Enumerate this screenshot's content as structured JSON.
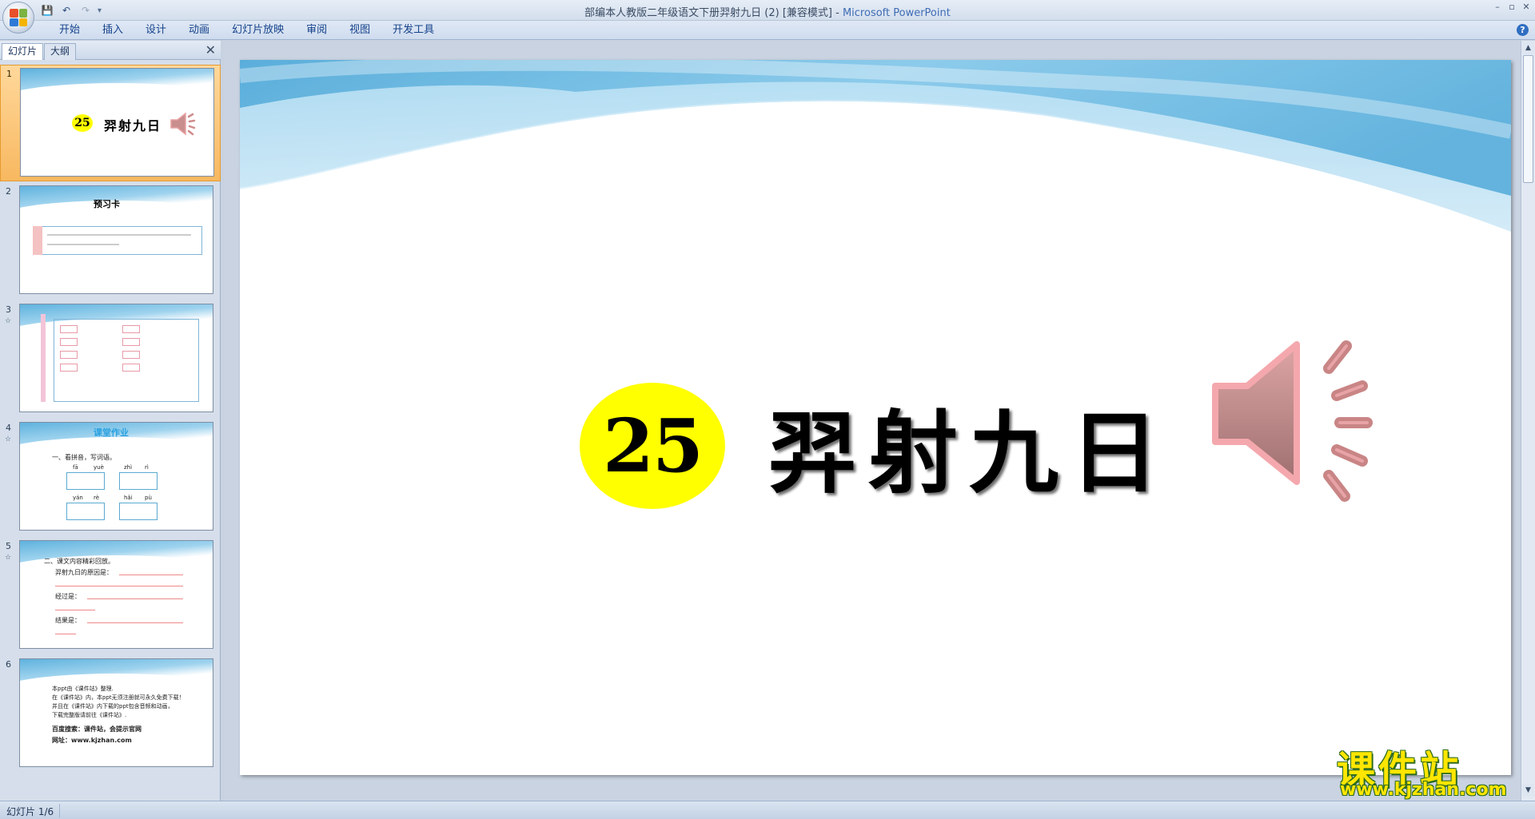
{
  "window": {
    "title_doc": "部编本人教版二年级语文下册羿射九日 (2) [兼容模式] - ",
    "title_app": "Microsoft PowerPoint",
    "minimize": "–",
    "restore": "▫",
    "close": "✕"
  },
  "qat": {
    "save": "💾",
    "undo": "↶",
    "redo": "↷",
    "more": "▾"
  },
  "ribbon": {
    "tabs": [
      "开始",
      "插入",
      "设计",
      "动画",
      "幻灯片放映",
      "审阅",
      "视图",
      "开发工具"
    ],
    "help": "?"
  },
  "panel": {
    "tabs": [
      "幻灯片",
      "大纲"
    ],
    "close": "✕"
  },
  "thumbnails": [
    {
      "num": "1",
      "badge": "25",
      "title": "羿射九日"
    },
    {
      "num": "2",
      "heading": "预习卡"
    },
    {
      "num": "3"
    },
    {
      "num": "4",
      "heading": "课堂作业",
      "line1": "一、看拼音，写词语。",
      "pinyin": [
        "fā",
        "yuè",
        "zhì",
        "rì",
        "yán",
        "rè",
        "hǎi",
        "pù"
      ]
    },
    {
      "num": "5",
      "line1": "二、课文内容精彩回放。",
      "line2": "羿射九日的原因是：",
      "line3": "经过是：",
      "line4": "结果是："
    },
    {
      "num": "6",
      "line1": "本ppt由《课件站》整理.",
      "line2": "在《课件站》内，本ppt无须注册就可永久免费下载！",
      "line3": "并且在《课件站》内下载的ppt包含音频和动画，",
      "line4": "下载完整版请前往《课件站》.",
      "line5": "百度搜索：课件站，会提示官网",
      "line6": "网址：www.kjzhan.com"
    }
  ],
  "slide": {
    "badge": "25",
    "title": "羿射九日"
  },
  "status": {
    "slide_counter": "幻灯片 1/6"
  },
  "watermark": {
    "name": "课件站",
    "url": "www.kjzhan.com"
  },
  "colors": {
    "badge": "#ffff00",
    "speaker": "#c98e8e",
    "selected_thumb": "#f8b860"
  }
}
